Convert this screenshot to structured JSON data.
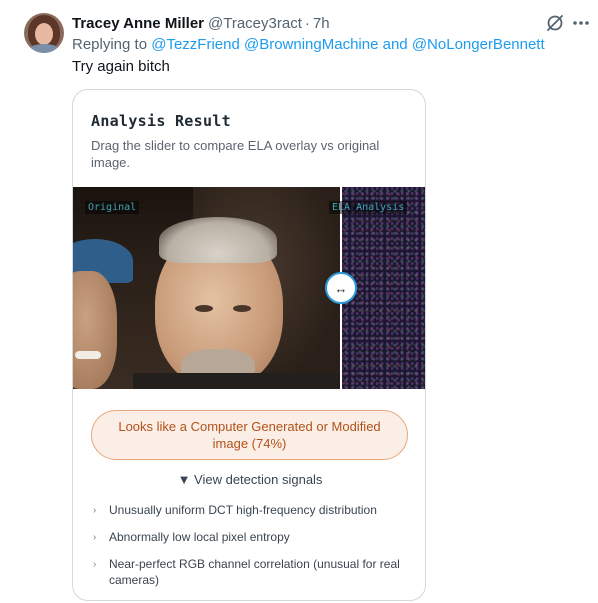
{
  "tweet": {
    "author_name": "Tracey Anne Miller",
    "author_handle": "@Tracey3ract",
    "separator": "·",
    "time": "7h",
    "replying_prefix": "Replying to",
    "replying_to": [
      "@TezzFriend",
      "@BrowningMachine"
    ],
    "replying_and": "and",
    "replying_last": "@NoLongerBennett",
    "text": "Try again bitch"
  },
  "card": {
    "title": "Analysis Result",
    "subtitle": "Drag the slider to compare ELA overlay vs original image.",
    "label_original": "Original",
    "label_ela": "ELA Analysis",
    "slider_glyph": "↔",
    "verdict": "Looks like a Computer Generated or Modified image (74%)",
    "signals_toggle": "▼ View detection signals",
    "signals": [
      "Unusually uniform DCT high-frequency distribution",
      "Abnormally low local pixel entropy",
      "Near-perfect RGB channel correlation (unusual for real cameras)"
    ]
  },
  "icons": {
    "avatar": "avatar",
    "grok": "grok-icon",
    "more": "more-icon",
    "chevron": "›"
  },
  "colors": {
    "link": "#1d9bf0",
    "muted": "#536471",
    "verdict_text": "#b2521a",
    "verdict_border": "#e7a87d",
    "verdict_bg": "#fbeee6",
    "slider_border": "#2d9bd6"
  }
}
